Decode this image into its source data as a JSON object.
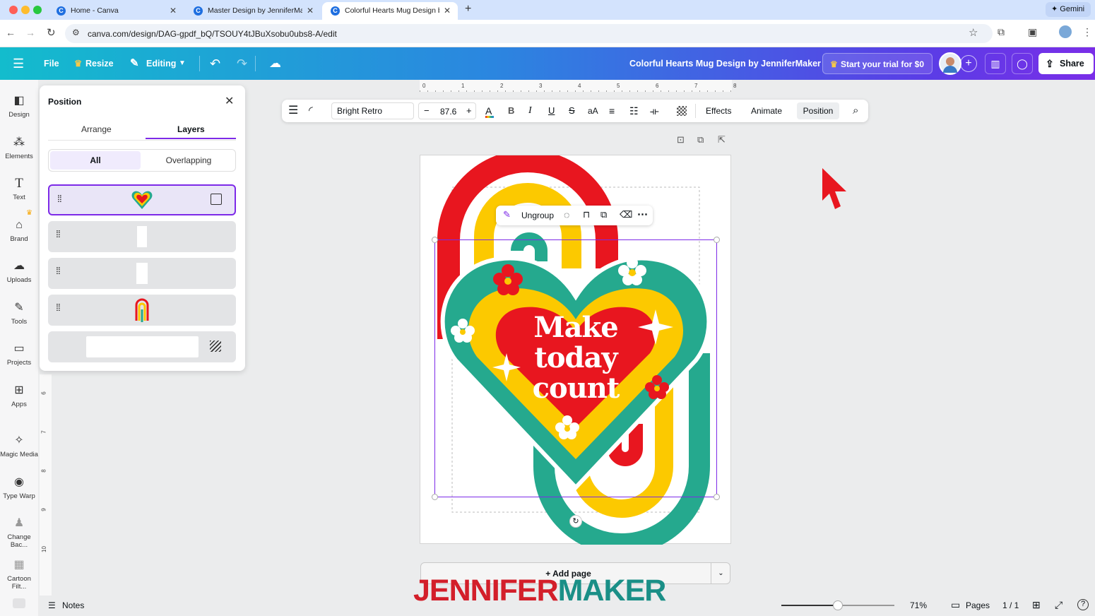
{
  "browser": {
    "tabs": [
      {
        "title": "Home - Canva"
      },
      {
        "title": "Master Design by JenniferMa"
      },
      {
        "title": "Colorful Hearts Mug Design b"
      }
    ],
    "url": "canva.com/design/DAG-gpdf_bQ/TSOUY4tJBuXsobu0ubs8-A/edit",
    "gemini": "Gemini"
  },
  "header": {
    "file": "File",
    "resize": "Resize",
    "editing": "Editing",
    "title": "Colorful Hearts Mug Design by JenniferMaker",
    "trial": "Start your trial for $0",
    "share": "Share"
  },
  "rail": {
    "items": [
      {
        "label": "Design",
        "icon": "design-icon"
      },
      {
        "label": "Elements",
        "icon": "elements-icon"
      },
      {
        "label": "Text",
        "icon": "text-icon"
      },
      {
        "label": "Brand",
        "icon": "brand-icon"
      },
      {
        "label": "Uploads",
        "icon": "uploads-icon"
      },
      {
        "label": "Tools",
        "icon": "tools-icon"
      },
      {
        "label": "Projects",
        "icon": "projects-icon"
      },
      {
        "label": "Apps",
        "icon": "apps-icon"
      },
      {
        "label": "Magic Media",
        "icon": "magic-media-icon"
      },
      {
        "label": "Type Warp",
        "icon": "type-warp-icon"
      },
      {
        "label": "Change Bac...",
        "icon": "change-background-icon"
      },
      {
        "label": "Cartoon Filt...",
        "icon": "cartoon-filter-icon"
      }
    ]
  },
  "panel": {
    "title": "Position",
    "tabs": [
      "Arrange",
      "Layers"
    ],
    "active_tab": "Layers",
    "filters": [
      "All",
      "Overlapping"
    ],
    "active_filter": "All"
  },
  "toolbar": {
    "font": "Bright Retro",
    "size": "87.6",
    "effects": "Effects",
    "animate": "Animate",
    "position": "Position"
  },
  "ruler": {
    "ticks": [
      "0",
      "1",
      "2",
      "3",
      "4",
      "5",
      "6",
      "7",
      "8"
    ],
    "vticks": [
      "6",
      "7",
      "8",
      "9",
      "10"
    ]
  },
  "canvas": {
    "heart_text": [
      "Make",
      "today",
      "count"
    ],
    "floatbar": {
      "ungroup": "Ungroup"
    },
    "add_page": "+ Add page"
  },
  "watermark": {
    "part1": "JENNIFER",
    "part2": "MAKER"
  },
  "footer": {
    "notes": "Notes",
    "zoom": "71%",
    "zoom_level": 0.5,
    "pages": "Pages",
    "page_count": "1 / 1"
  },
  "colors": {
    "accent": "#7d2ae8",
    "red": "#e8161f",
    "yellow": "#fcc900",
    "green": "#25a98e"
  }
}
